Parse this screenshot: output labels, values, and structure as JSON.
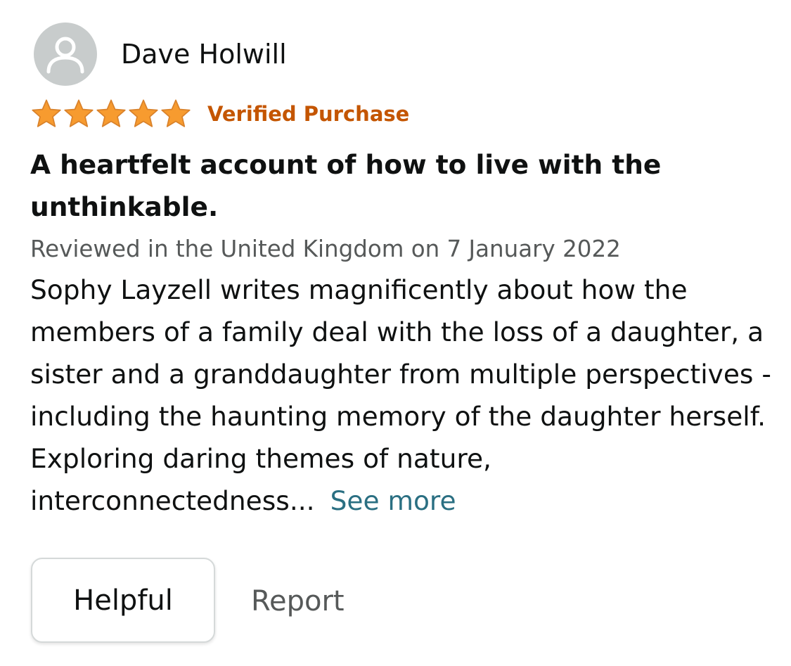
{
  "review": {
    "reviewer_name": "Dave Holwill",
    "avatar_icon": "user-silhouette-icon",
    "rating": {
      "stars": 5,
      "max_stars": 5,
      "star_icon": "star-icon",
      "star_color": "#f79b2f"
    },
    "verified_label": "Verified Purchase",
    "title": "A heartfelt account of how to live with the unthinkable.",
    "date_line": "Reviewed in the United Kingdom on 7 January 2022",
    "body": "Sophy Layzell writes magnificently about how the members of a family deal with the loss of a daughter, a sister and a granddaughter from multiple perspectives - including the haunting memory of the daughter herself. Exploring daring themes of nature, interconnectedness...",
    "see_more_label": "See more",
    "helpful_label": "Helpful",
    "report_label": "Report"
  },
  "colors": {
    "verified": "#c45500",
    "link": "#2a6f82",
    "secondary_text": "#565959",
    "avatar_background": "#c8cccc"
  }
}
